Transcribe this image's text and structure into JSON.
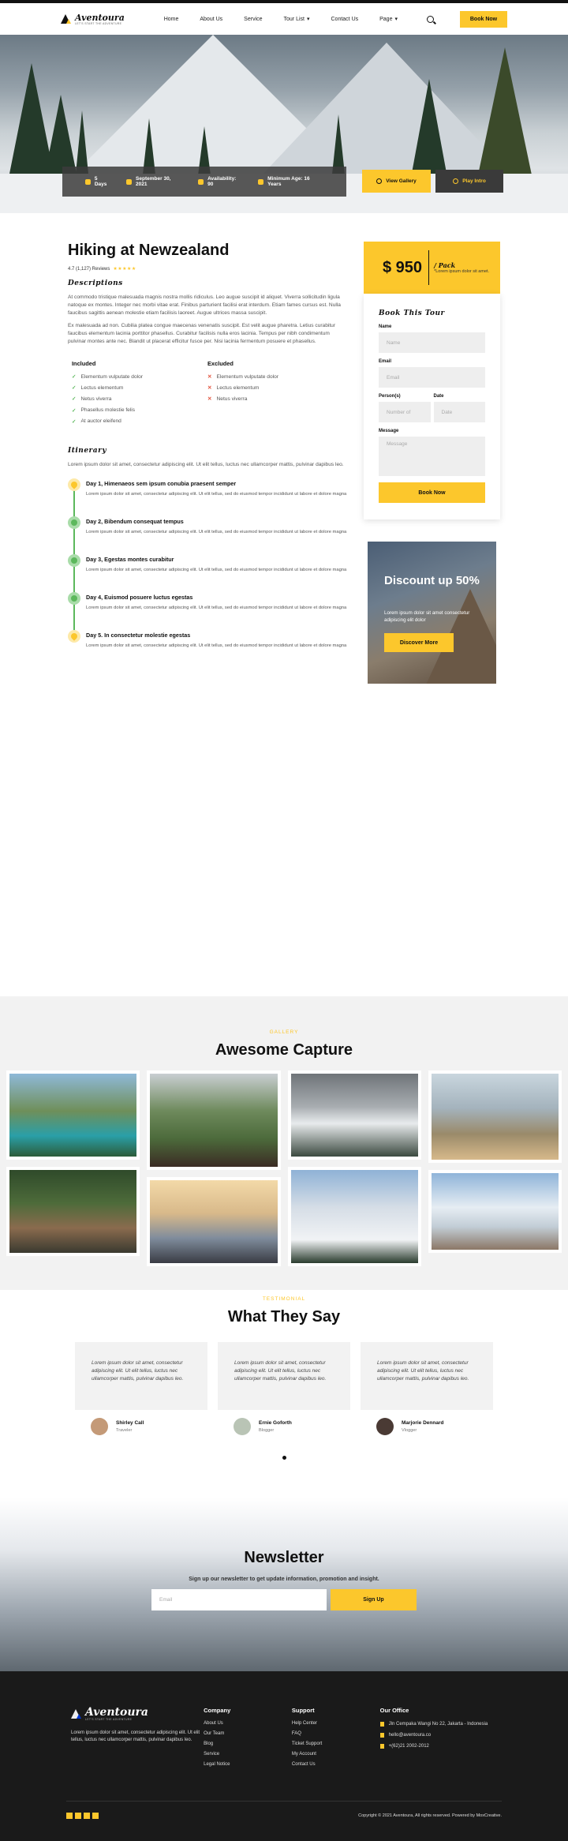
{
  "brand": {
    "name": "Aventoura",
    "tagline": "LET'S START THE ADVENTURE"
  },
  "nav": {
    "items": [
      "Home",
      "About Us",
      "Service",
      "Tour List",
      "Contact Us",
      "Page"
    ],
    "book_now": "Book Now"
  },
  "hero": {
    "days": "5 Days",
    "date": "September 30, 2021",
    "availability": "Availability: 90",
    "min_age": "Minimum Age: 16 Years",
    "gallery_btn": "View Gallery",
    "play_btn": "Play Intro"
  },
  "tour": {
    "title": "Hiking at Newzealand",
    "rating": "4.7 (1,127) Reviews",
    "stars": "★★★★★",
    "desc_title": "Descriptions",
    "desc_1": "At commodo tristique malesuada magnis nostra mollis ridiculus. Leo augue suscipit id aliquet. Viverra sollicitudin ligula natoque ex montes. Integer nec morbi vitae erat. Finibus parturient facilisi erat interdum. Etiam fames cursus est. Nulla faucibus sagittis aenean molestie etiam facilisis laoreet. Augue ultrices massa suscipit.",
    "desc_2": "Ex malesuada ad non. Cubilia platea congue maecenas venenatis suscipit. Est velit augue pharetra. Letius curabitur faucibus elementum lacinia porttitor phasellus. Curabitur facilisis nulla eros lacinia. Tempus per nibh condimentum pulvinar montes ante nec. Blandit ut placerat efficitur fusce per. Nisi lacinia fermentum posuere et phasellus.",
    "included_title": "Included",
    "included": [
      "Elementum vulputate dolor",
      "Lectus elementum",
      "Netus viverra",
      "Phasellus molestie felis",
      "At auctor eleifend"
    ],
    "excluded_title": "Excluded",
    "excluded": [
      "Elementum vulputate dolor",
      "Lectus elementum",
      "Netus viverra"
    ],
    "itinerary_title": "Itinerary",
    "itinerary_intro": "Lorem ipsum dolor sit amet, consectetur adipiscing elit. Ut elit tellus, luctus nec ullamcorper mattis, pulvinar dapibus leo.",
    "days": [
      {
        "title": "Day 1, Himenaeos sem ipsum conubia praesent semper",
        "text": "Lorem ipsum dolor sit amet, consectetur adipiscing elit. Ut elit tellus, sed do eiusmod tempor incididunt ut labore et dolore magna"
      },
      {
        "title": "Day 2, Bibendum consequat tempus",
        "text": "Lorem ipsum dolor sit amet, consectetur adipiscing elit. Ut elit tellus, sed do eiusmod tempor incididunt ut labore et dolore magna"
      },
      {
        "title": "Day 3, Egestas montes curabitur",
        "text": "Lorem ipsum dolor sit amet, consectetur adipiscing elit. Ut elit tellus, sed do eiusmod tempor incididunt ut labore et dolore magna"
      },
      {
        "title": "Day 4, Euismod posuere luctus egestas",
        "text": "Lorem ipsum dolor sit amet, consectetur adipiscing elit. Ut elit tellus, sed do eiusmod tempor incididunt ut labore et dolore magna"
      },
      {
        "title": "Day 5. In consectetur molestie egestas",
        "text": "Lorem ipsum dolor sit amet, consectetur adipiscing elit. Ut elit tellus, sed do eiusmod tempor incididunt ut labore et dolore magna"
      }
    ]
  },
  "booking": {
    "price": "$ 950",
    "pack": "/ Pack",
    "pack_note": "*Lorem ipsum dolor sit amet.",
    "title": "Book This Tour",
    "name_label": "Name",
    "name_ph": "Name",
    "email_label": "Email",
    "email_ph": "Email",
    "persons_label": "Person(s)",
    "persons_ph": "Number of",
    "date_label": "Date",
    "date_ph": "Date",
    "message_label": "Message",
    "message_ph": "Message",
    "submit": "Book Now"
  },
  "promo": {
    "title": "Discount up 50%",
    "text": "Lorem ipsum dolor sit amet consectetur adipiscing elit dolor",
    "button": "Discover More"
  },
  "gallery": {
    "tag": "GALLERY",
    "title": "Awesome Capture"
  },
  "testimonial": {
    "tag": "TESTIMONIAL",
    "title": "What They Say",
    "items": [
      {
        "quote": "Lorem ipsum dolor sit amet, consectetur adipiscing elit. Ut elit tellus, luctus nec ullamcorper mattis, pulvinar dapibus leo.",
        "name": "Shirley Call",
        "role": "Traveler"
      },
      {
        "quote": "Lorem ipsum dolor sit amet, consectetur adipiscing elit. Ut elit tellus, luctus nec ullamcorper mattis, pulvinar dapibus leo.",
        "name": "Ernie Goforth",
        "role": "Blogger"
      },
      {
        "quote": "Lorem ipsum dolor sit amet, consectetur adipiscing elit. Ut elit tellus, luctus nec ullamcorper mattis, pulvinar dapibus leo.",
        "name": "Marjorie Dennard",
        "role": "Vlogger"
      }
    ]
  },
  "newsletter": {
    "title": "Newsletter",
    "text": "Sign up our newsletter to get update information, promotion and insight.",
    "email_ph": "Email",
    "button": "Sign Up"
  },
  "footer": {
    "about": "Lorem ipsum dolor sit amet, consectetur adipiscing elit. Ut elit tellus, luctus nec ullamcorper mattis, pulvinar dapibus leo.",
    "company_title": "Company",
    "company": [
      "About Us",
      "Our Team",
      "Blog",
      "Service",
      "Legal Notice"
    ],
    "support_title": "Support",
    "support": [
      "Help Center",
      "FAQ",
      "Ticket Support",
      "My Account",
      "Contact Us"
    ],
    "office_title": "Our Office",
    "address": "Jln Cempaka Wangi No 22, Jakarta - Indonesia",
    "email": "hello@aventoura.co",
    "phone": "+(62)21 2002-2012",
    "copyright": "Copyright © 2021 Aventoura, All rights reserved. Powered by MoxCreative."
  },
  "colors": {
    "accent": "#fcc72c",
    "dark": "#1a1a1a",
    "success": "#5cb85c",
    "danger": "#e2513b"
  }
}
